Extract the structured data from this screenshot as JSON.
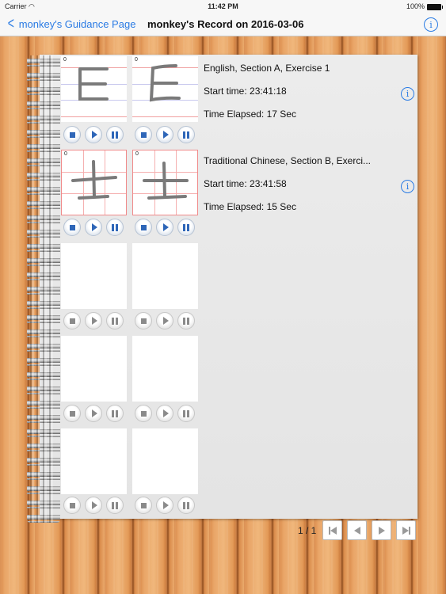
{
  "status_bar": {
    "carrier": "Carrier",
    "wifi_icon": "wifi-icon",
    "time": "11:42 PM",
    "battery": "100%"
  },
  "nav": {
    "back_label": "monkey's Guidance Page",
    "title": "monkey's Record on 2016-03-06",
    "info_icon": "i"
  },
  "cells": [
    {
      "index": "0",
      "type": "ruled",
      "char": "E"
    },
    {
      "index": "0",
      "type": "ruled",
      "char": "E"
    },
    {
      "index": "0",
      "type": "grid",
      "char": "土"
    },
    {
      "index": "0",
      "type": "grid",
      "char": "土"
    },
    {
      "index": "",
      "type": "blank"
    },
    {
      "index": "",
      "type": "blank"
    },
    {
      "index": "",
      "type": "blank"
    },
    {
      "index": "",
      "type": "blank"
    },
    {
      "index": "",
      "type": "blank"
    },
    {
      "index": "",
      "type": "blank"
    }
  ],
  "records": [
    {
      "title": "English, Section A, Exercise 1",
      "start": "Start time: 23:41:18",
      "elapsed": "Time Elapsed: 17 Sec",
      "info_icon": "i"
    },
    {
      "title": "Traditional Chinese, Section B, Exerci...",
      "start": "Start time: 23:41:58",
      "elapsed": "Time Elapsed: 15 Sec",
      "info_icon": "i"
    }
  ],
  "pager": {
    "label": "1 / 1",
    "current_page": 1,
    "total_pages": 1
  },
  "colors": {
    "accent": "#2a7be4",
    "control_blue": "#2e66b8",
    "ruled_red": "#f0a0a0",
    "ruled_blue": "#c8c8ee"
  }
}
